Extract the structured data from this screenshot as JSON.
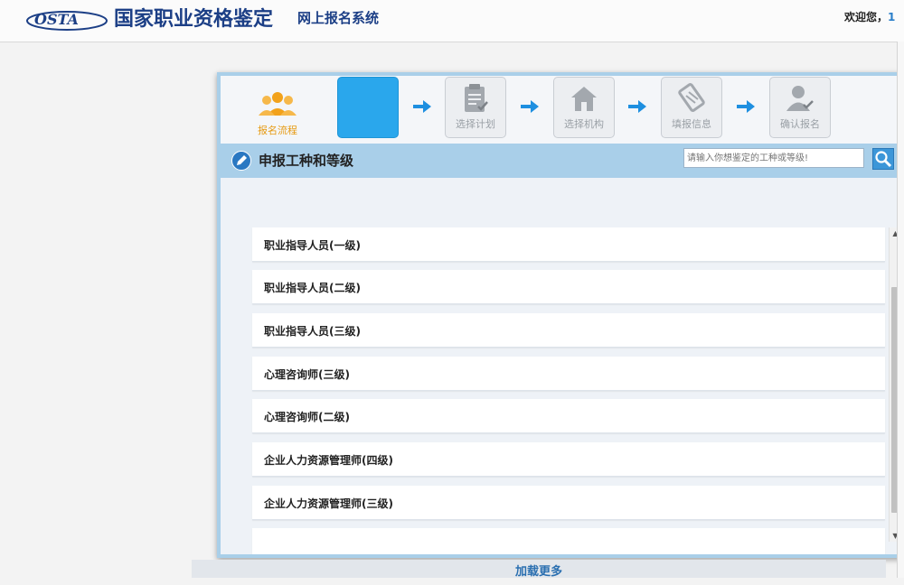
{
  "header": {
    "logo_text": "OSTA",
    "title": "国家职业资格鉴定",
    "subtitle": "网上报名系统",
    "welcome": "欢迎您，",
    "user": "1"
  },
  "steps": {
    "process_label": "报名流程",
    "items": [
      {
        "label": "",
        "icon": "active-step",
        "active": true
      },
      {
        "label": "选择计划",
        "icon": "plan-document-icon"
      },
      {
        "label": "选择机构",
        "icon": "institution-building-icon"
      },
      {
        "label": "填报信息",
        "icon": "fill-info-icon"
      },
      {
        "label": "确认报名",
        "icon": "confirm-user-icon"
      }
    ]
  },
  "section": {
    "title": "申报工种和等级",
    "search_placeholder": "请输入你想鉴定的工种或等级!"
  },
  "list": [
    "职业指导人员(一级)",
    "职业指导人员(二级)",
    "职业指导人员(三级)",
    "心理咨询师(三级)",
    "心理咨询师(二级)",
    "企业人力资源管理师(四级)",
    "企业人力资源管理师(三级)",
    ""
  ],
  "footer": {
    "load_more": "加载更多"
  },
  "colors": {
    "brand": "#1c3f86",
    "accent": "#2aa7ec",
    "panel": "#a9cfe9",
    "process_label": "#e69a12"
  }
}
